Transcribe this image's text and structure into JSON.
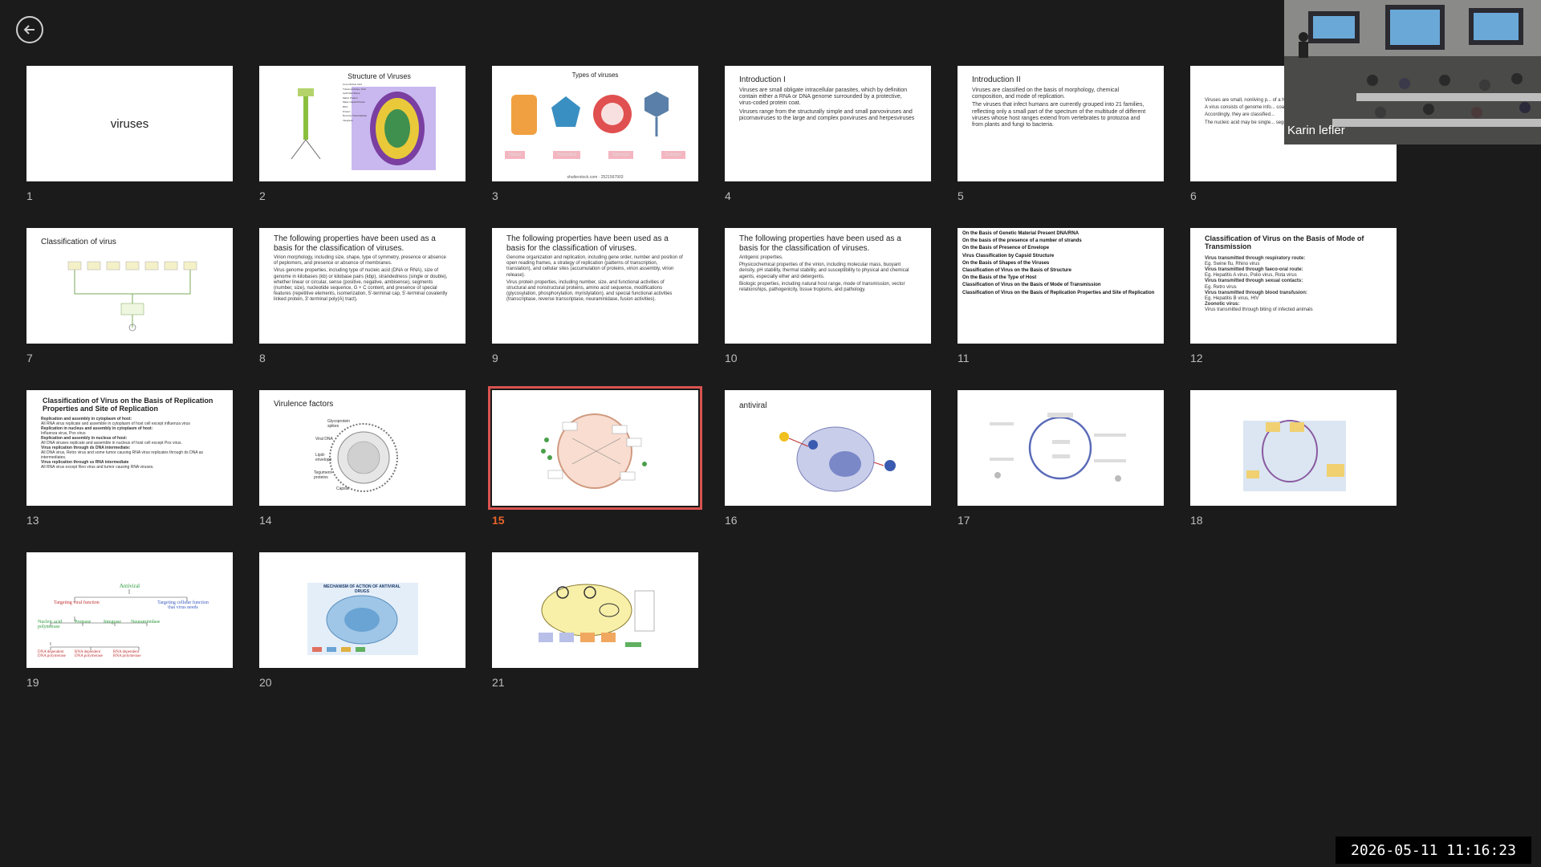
{
  "timestamp": "2026-05-11  11:16:23",
  "video": {
    "name": "Karin lefler"
  },
  "slides": [
    {
      "number": "1",
      "title": "viruses"
    },
    {
      "number": "2",
      "title": "Structure of Viruses",
      "labels": [
        "Core Nucleic Acid",
        "Transmembrane Viral",
        "Lipid Membrane",
        "Matrix Protein",
        "Major Capsid Protein",
        "RNA",
        "Protein",
        "Reverse Transcriptase",
        "Integrase"
      ]
    },
    {
      "number": "3",
      "title": "Types of viruses",
      "labels": [
        "Helical",
        "Polyhedral",
        "Spherical",
        "Complex"
      ],
      "caption": "shutterstock.com · 2521567903"
    },
    {
      "number": "4",
      "title": "Introduction I",
      "bullets": [
        "Viruses are small obligate intracellular parasites, which by definition contain either a RNA or DNA genome surrounded by a protective, virus-coded protein coat.",
        "Viruses range from the structurally simple and small parvoviruses and picornaviruses to the large and complex poxviruses and herpesviruses"
      ]
    },
    {
      "number": "5",
      "title": "Introduction II",
      "bullets": [
        "Viruses are classified on the basis of morphology, chemical composition, and mode of replication.",
        "The viruses that infect humans are currently grouped into 21 families, reflecting only a small part of the spectrum of the multitude of different viruses whose host ranges extend from vertebrates to protozoa and from plants and fungi to bacteria."
      ]
    },
    {
      "number": "6",
      "bullets": [
        "Viruses are small, nonliving p... of a host cell.",
        "A virus consists of genome info... coated by a protein.",
        "Accordingly, they are classified...",
        "The nucleic acid may be single... segmented or unsegmented."
      ]
    },
    {
      "number": "7",
      "title": "Classification of virus"
    },
    {
      "number": "8",
      "title": "The following properties have been used as a basis for the classification of viruses.",
      "bullets": [
        "Virion morphology, including size, shape, type of symmetry, presence or absence of peplomers, and presence or absence of membranes.",
        "Virus genome properties, including type of nucleic acid (DNA or RNA), size of genome in kilobases (kb) or kilobase pairs (kbp), strandedness (single or double), whether linear or circular, sense (positive, negative, ambisense), segments (number, size), nucleotide sequence, G + C content, and presence of special features (repetitive elements, isomerization, 5'-terminal cap, 5'-terminal covalently linked protein, 3'-terminal poly(A) tract)."
      ]
    },
    {
      "number": "9",
      "title": "The following properties have been used as a basis for the classification of viruses.",
      "bullets": [
        "Genome organization and replication, including gene order, number and position of open reading frames, a strategy of replication (patterns of transcription, translation), and cellular sites (accumulation of proteins, virion assembly, virion release).",
        "Virus protein properties, including number, size, and functional activities of structural and nonstructural proteins, amino acid sequence, modifications (glycosylation, phosphorylation, myristylation), and special functional activities (transcriptase, reverse transcriptase, neuraminidase, fusion activities)."
      ]
    },
    {
      "number": "10",
      "title": "The following properties have been used as a basis for the classification of viruses.",
      "bullets": [
        "Antigenic properties.",
        "Physicochemical properties of the virion, including molecular mass, buoyant density, pH stability, thermal stability, and susceptibility to physical and chemical agents, especially ether and detergents.",
        "Biologic properties, including natural host range, mode of transmission, vector relationships, pathogenicity, tissue tropisms, and pathology."
      ]
    },
    {
      "number": "11",
      "bullets": [
        "On the Basis of Genetic Material Present DNA/RNA",
        "On the basis of the presence of a number of strands",
        "On the Basis of Presence of Envelope",
        "Virus Classification by Capsid Structure",
        "On the Basis of Shapes of the Viruses",
        "Classification of Virus on the Basis of Structure",
        "On the Basis of the Type of Host",
        "Classification of Virus on the Basis of Mode of Transmission",
        "Classification of Virus on the Basis of Replication Properties and Site of Replication"
      ]
    },
    {
      "number": "12",
      "title": "Classification of Virus on the Basis of Mode of Transmission",
      "bullets": [
        "Virus transmitted through respiratory route:",
        "Eg. Swine flu, Rhino virus",
        "Virus transmitted through faeco-oral route:",
        "Eg. Hepatitis A virus, Polio virus, Rota virus",
        "Virus transmitted through sexual contacts:",
        "Eg. Retro virus",
        "Virus transmitted through blood transfusion:",
        "Eg. Hepatitis B virus, HIV",
        "Zoonotic virus:",
        "Virus transmitted through biting of infected animals"
      ]
    },
    {
      "number": "13",
      "title": "Classification of Virus on the Basis of Replication Properties and Site of Replication",
      "bullets": [
        "Replication and assembly in cytoplasm of host:",
        "All RNA virus replicate and assemble in cytoplasm of host cell except influenza virus",
        "Replication in nucleus and assembly in cytoplasm of host:",
        "Influenza virus, Pox virus",
        "Replication and assembly in nucleus of host:",
        "All DNA viruses replicate and assemble in nucleus of host cell except Pox virus.",
        "Virus replication through ds DNA intermediate:",
        "All DNA virus, Retro virus and some tumor causing RNA virus replicates through ds DNA as intermediates.",
        "Virus replication through ss RNA intermediate",
        "All RNA virus except Reo virus and tumor causing RNA viruses."
      ]
    },
    {
      "number": "14",
      "title": "Virulence factors",
      "labels": [
        "Glycoprotein spikes",
        "Viral DNA",
        "Lipid-envelope",
        "Tegument-proteins",
        "Capsid"
      ]
    },
    {
      "number": "15",
      "selected": true
    },
    {
      "number": "16",
      "title": "antiviral"
    },
    {
      "number": "17"
    },
    {
      "number": "18"
    },
    {
      "number": "19",
      "labels": [
        "Antiviral",
        "Targeting viral function",
        "Targeting cellular function that virus needs",
        "Nucleic acid polymerase",
        "Protease",
        "Integrase",
        "Neuraminidase",
        "DNA dependent DNA polymerase",
        "RNA dependent DNA polymerase",
        "RNA dependent RNA polymerase"
      ]
    },
    {
      "number": "20",
      "title": "MECHANISM OF ACTION OF ANTIVIRAL DRUGS"
    },
    {
      "number": "21"
    }
  ]
}
